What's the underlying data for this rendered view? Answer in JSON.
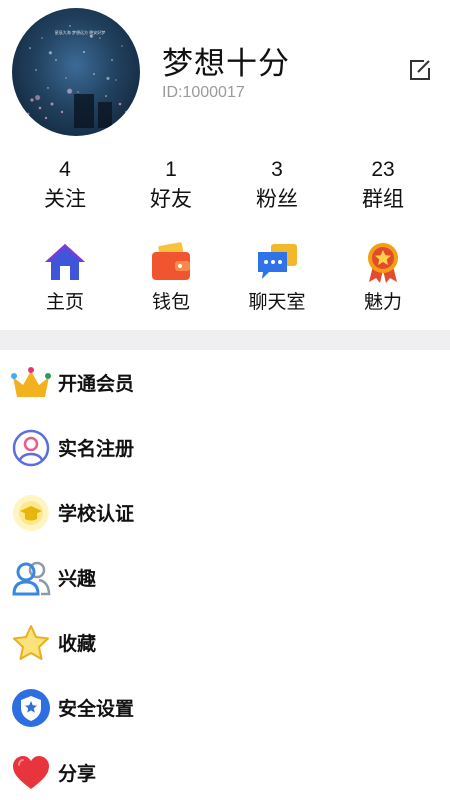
{
  "profile": {
    "name": "梦想十分",
    "id": "ID:1000017",
    "avatar_caption": "星辰大海 梦想远方 晚安好梦"
  },
  "stats": [
    {
      "count": "4",
      "label": "关注"
    },
    {
      "count": "1",
      "label": "好友"
    },
    {
      "count": "3",
      "label": "粉丝"
    },
    {
      "count": "23",
      "label": "群组"
    }
  ],
  "actions": [
    {
      "label": "主页",
      "icon": "home-icon"
    },
    {
      "label": "钱包",
      "icon": "wallet-icon"
    },
    {
      "label": "聊天室",
      "icon": "chat-icon"
    },
    {
      "label": "魅力",
      "icon": "medal-icon"
    }
  ],
  "menu": [
    {
      "label": "开通会员",
      "icon": "crown-icon"
    },
    {
      "label": "实名注册",
      "icon": "user-verify-icon"
    },
    {
      "label": "学校认证",
      "icon": "graduation-cap-icon"
    },
    {
      "label": "兴趣",
      "icon": "people-icon"
    },
    {
      "label": "收藏",
      "icon": "star-icon"
    },
    {
      "label": "安全设置",
      "icon": "shield-icon"
    },
    {
      "label": "分享",
      "icon": "heart-icon"
    }
  ],
  "colors": {
    "divider": "#efeff1",
    "home": "#3f56d9",
    "wallet": "#f0552f",
    "chat": "#2f72ea",
    "medal": "#f0a010",
    "crown": "#f2b21f",
    "shield": "#2d6fe0",
    "heart": "#e8353d"
  }
}
